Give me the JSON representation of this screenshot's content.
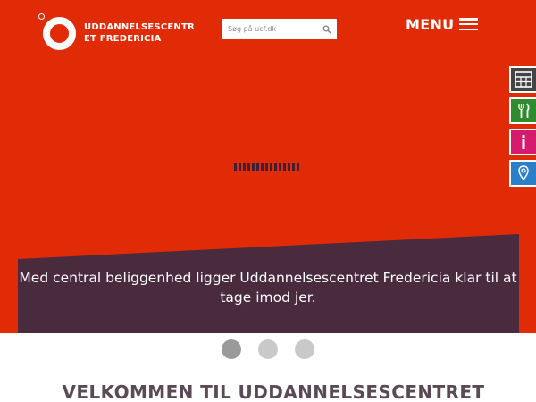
{
  "header": {
    "logo_text": "UDDANNELSESCENTRET FREDERICIA",
    "search_placeholder": "Søg på ucf.dk",
    "menu_label": "MENU"
  },
  "colors": {
    "hero_background": "#e12a06",
    "banner_background": "#4a2a3d",
    "calendar_button": "#444444",
    "food_button": "#2e8b2e",
    "info_button": "#d61a6e",
    "location_button": "#2a7fc8",
    "welcome_heading": "#5a4a55"
  },
  "side_buttons": [
    {
      "icon": "calendar-icon"
    },
    {
      "icon": "fork-knife-icon"
    },
    {
      "icon": "info-icon"
    },
    {
      "icon": "location-pin-icon"
    }
  ],
  "hero": {
    "caption": "Med central beliggenhed ligger Uddannelsescentret Fredericia klar til at tage imod jer."
  },
  "carousel": {
    "slide_count": 3,
    "active_index": 0
  },
  "main": {
    "welcome_heading": "VELKOMMEN TIL UDDANNELSESCENTRET"
  }
}
